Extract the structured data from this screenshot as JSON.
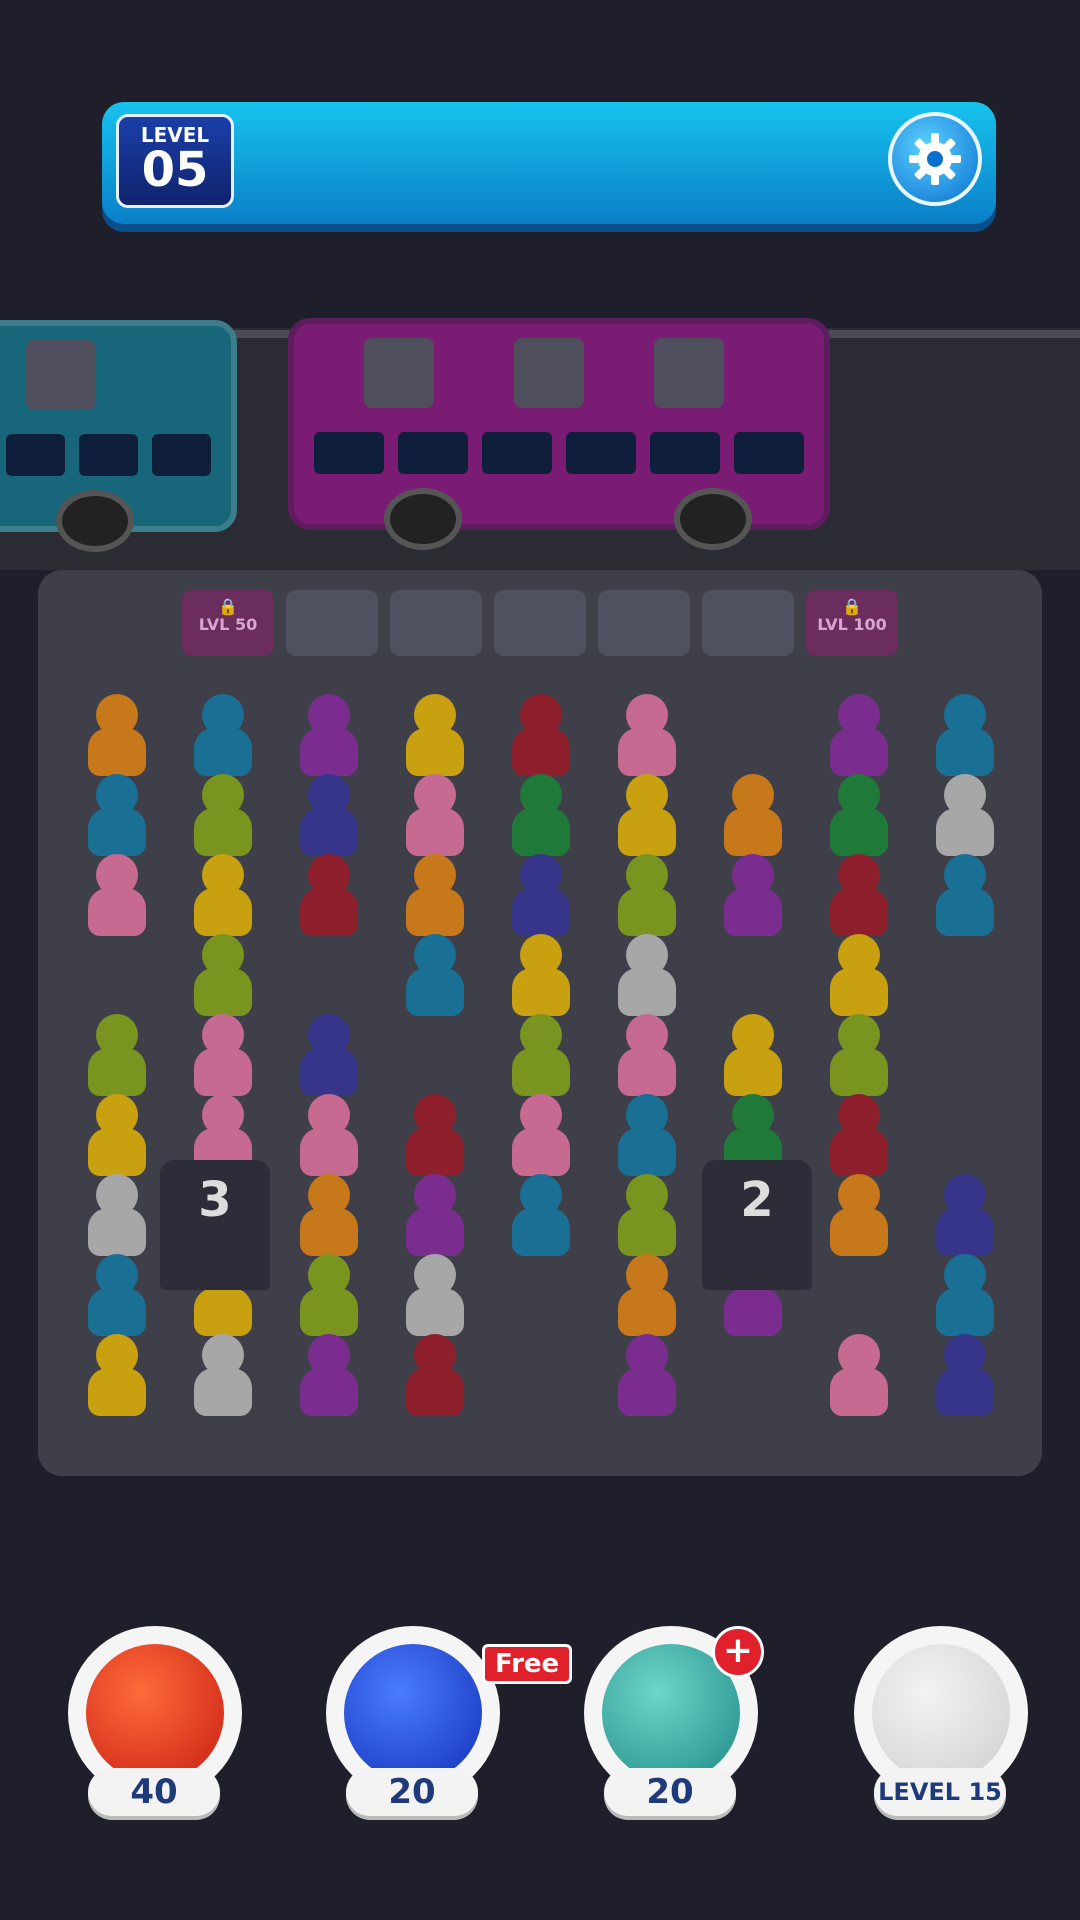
{
  "header": {
    "level_label": "LEVEL",
    "level_number": "05",
    "settings_icon": "gear-icon"
  },
  "slots": {
    "left_lock": "LVL 50",
    "right_lock": "LVL 100"
  },
  "tunnels": {
    "left": "3",
    "right": "2"
  },
  "powerups": {
    "undo": {
      "count": "40",
      "icon": "undo-arrow-icon"
    },
    "shuffle": {
      "count": "20",
      "tag": "Free",
      "icon": "shuffle-icon"
    },
    "freeze": {
      "count": "20",
      "tag": "+",
      "icon": "frozen-clock-icon"
    },
    "locked": {
      "label": "LEVEL 15",
      "icon": "padlock-icon"
    }
  },
  "colors": {
    "yellow": "#c8a010",
    "blue": "#1a6f95",
    "purple": "#7a2d8f",
    "red": "#8e1f2c",
    "pink": "#c66a92",
    "green": "#1f7a3a",
    "lime": "#7a9420",
    "orange": "#c6781a",
    "white": "#a7a7a7",
    "navy": "#36358a"
  }
}
